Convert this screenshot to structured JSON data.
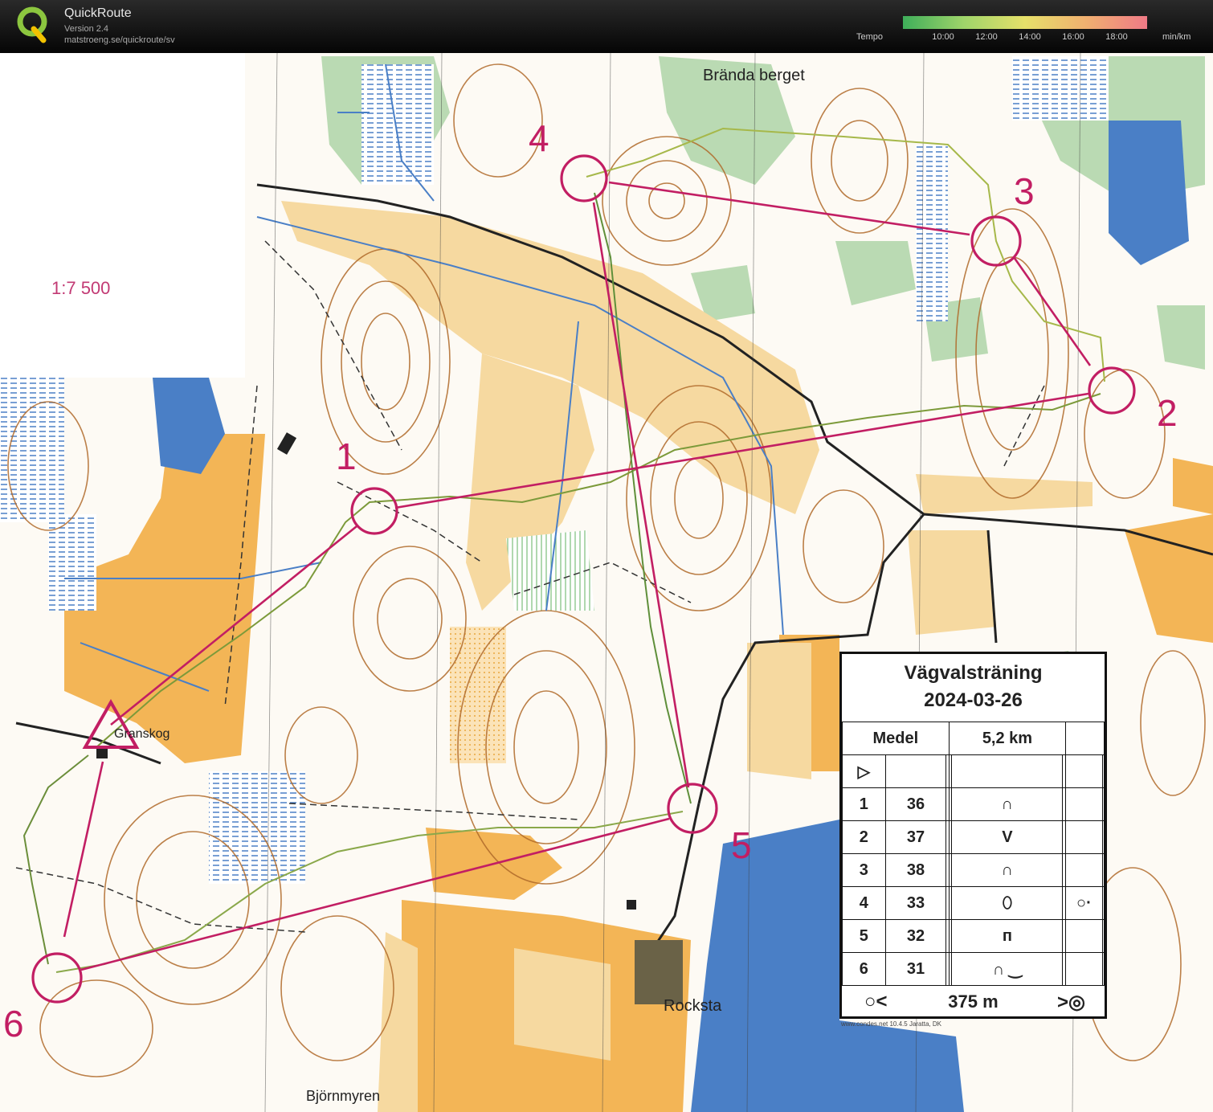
{
  "app": {
    "title": "QuickRoute",
    "version": "Version 2.4",
    "url": "matstroeng.se/quickroute/sv",
    "logo_letter": "Q"
  },
  "tempo": {
    "label": "Tempo",
    "ticks": [
      "10:00",
      "12:00",
      "14:00",
      "16:00",
      "18:00"
    ],
    "unit": "min/km",
    "colors": [
      "#3fae5a",
      "#9fd46a",
      "#e6e06a",
      "#f0b070",
      "#ef7a86"
    ]
  },
  "map": {
    "scale": "1:7 500",
    "place_names": [
      "Brända berget",
      "Granskog",
      "Rocksta",
      "Björnmyren"
    ],
    "control_numbers": [
      "1",
      "2",
      "3",
      "4",
      "5",
      "6"
    ],
    "colors": {
      "open_land": "#f3b556",
      "rough_open": "#f6d9a0",
      "water": "#4a7fc6",
      "marsh": "#4a7fc6",
      "green": "#9cc99a",
      "contour": "#b06a2a",
      "course": "#c21e63",
      "route": "#8aa84a"
    }
  },
  "card": {
    "title": "Vägvalsträning",
    "date": "2024-03-26",
    "class": "Medel",
    "length": "5,2 km",
    "start_symbol": "▷",
    "controls": [
      {
        "num": "1",
        "code": "36",
        "feature": "∩",
        "extra": ""
      },
      {
        "num": "2",
        "code": "37",
        "feature": "V",
        "extra": ""
      },
      {
        "num": "3",
        "code": "38",
        "feature": "∩",
        "extra": ""
      },
      {
        "num": "4",
        "code": "33",
        "feature": "⬯",
        "extra": "○·"
      },
      {
        "num": "5",
        "code": "32",
        "feature": "ᴨ",
        "extra": ""
      },
      {
        "num": "6",
        "code": "31",
        "feature": "∩ ‿",
        "extra": ""
      }
    ],
    "finish_left": "○<",
    "finish_distance": "375 m",
    "finish_right": ">◎"
  },
  "credit": "www.condes.net 10.4.5 Jaratta, DK"
}
